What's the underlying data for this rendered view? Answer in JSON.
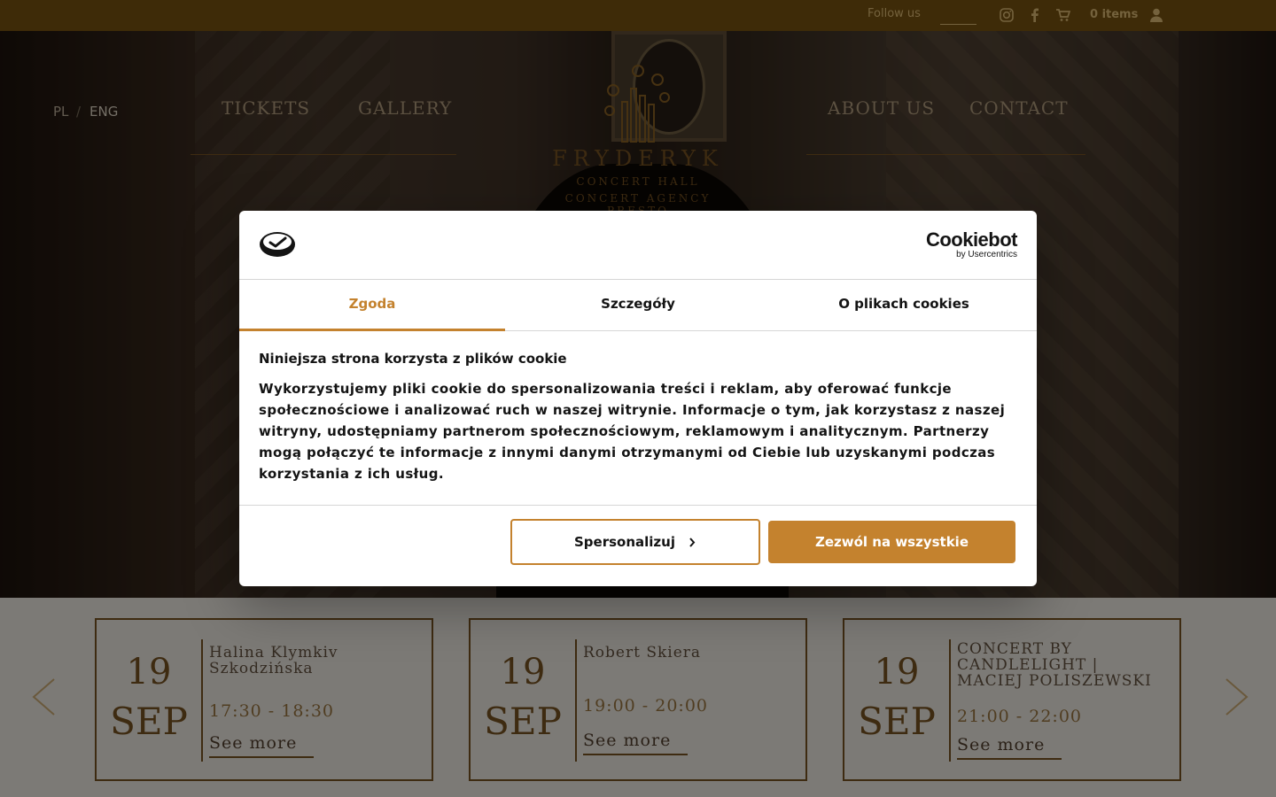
{
  "topbar": {
    "follow_label": "Follow us",
    "cart_label": "0 items",
    "icons": [
      "instagram-icon",
      "facebook-icon",
      "cart-icon",
      "user-icon"
    ]
  },
  "header": {
    "lang_pl": "PL",
    "lang_sep": "/",
    "lang_eng": "ENG",
    "nav": [
      "TICKETS",
      "GALLERY",
      "ABOUT US",
      "CONTACT"
    ],
    "logo": {
      "name": "FRYDERYK",
      "line1": "CONCERT HALL",
      "line2": "CONCERT AGENCY PRESTO"
    }
  },
  "events": [
    {
      "day": "19",
      "month": "SEP",
      "title": "Halina Klymkiv Szkodzińska",
      "time": "17:30 - 18:30",
      "more": "See more"
    },
    {
      "day": "19",
      "month": "SEP",
      "title": "Robert Skiera",
      "time": "19:00 - 20:00",
      "more": "See more"
    },
    {
      "day": "19",
      "month": "SEP",
      "title": "CONCERT BY CANDLELIGHT | MACIEJ POLISZEWSKI",
      "time": "21:00 - 22:00",
      "more": "See more"
    }
  ],
  "cookie": {
    "brand_main": "Cookiebot",
    "brand_sub": "by Usercentrics",
    "tabs": [
      "Zgoda",
      "Szczegóły",
      "O plikach cookies"
    ],
    "heading": "Niniejsza strona korzysta z plików cookie",
    "text": "Wykorzystujemy pliki cookie do spersonalizowania treści i reklam, aby oferować funkcje społecznościowe i analizować ruch w naszej witrynie. Informacje o tym, jak korzystasz z naszej witryny, udostępniamy partnerom społecznościowym, reklamowym i analitycznym. Partnerzy mogą połączyć te informacje z innymi danymi otrzymanymi od Ciebie lub uzyskanymi podczas korzystania z ich usług.",
    "btn_customize": "Spersonalizuj",
    "btn_allow_all": "Zezwól na wszystkie",
    "accent": "#c4822e"
  }
}
